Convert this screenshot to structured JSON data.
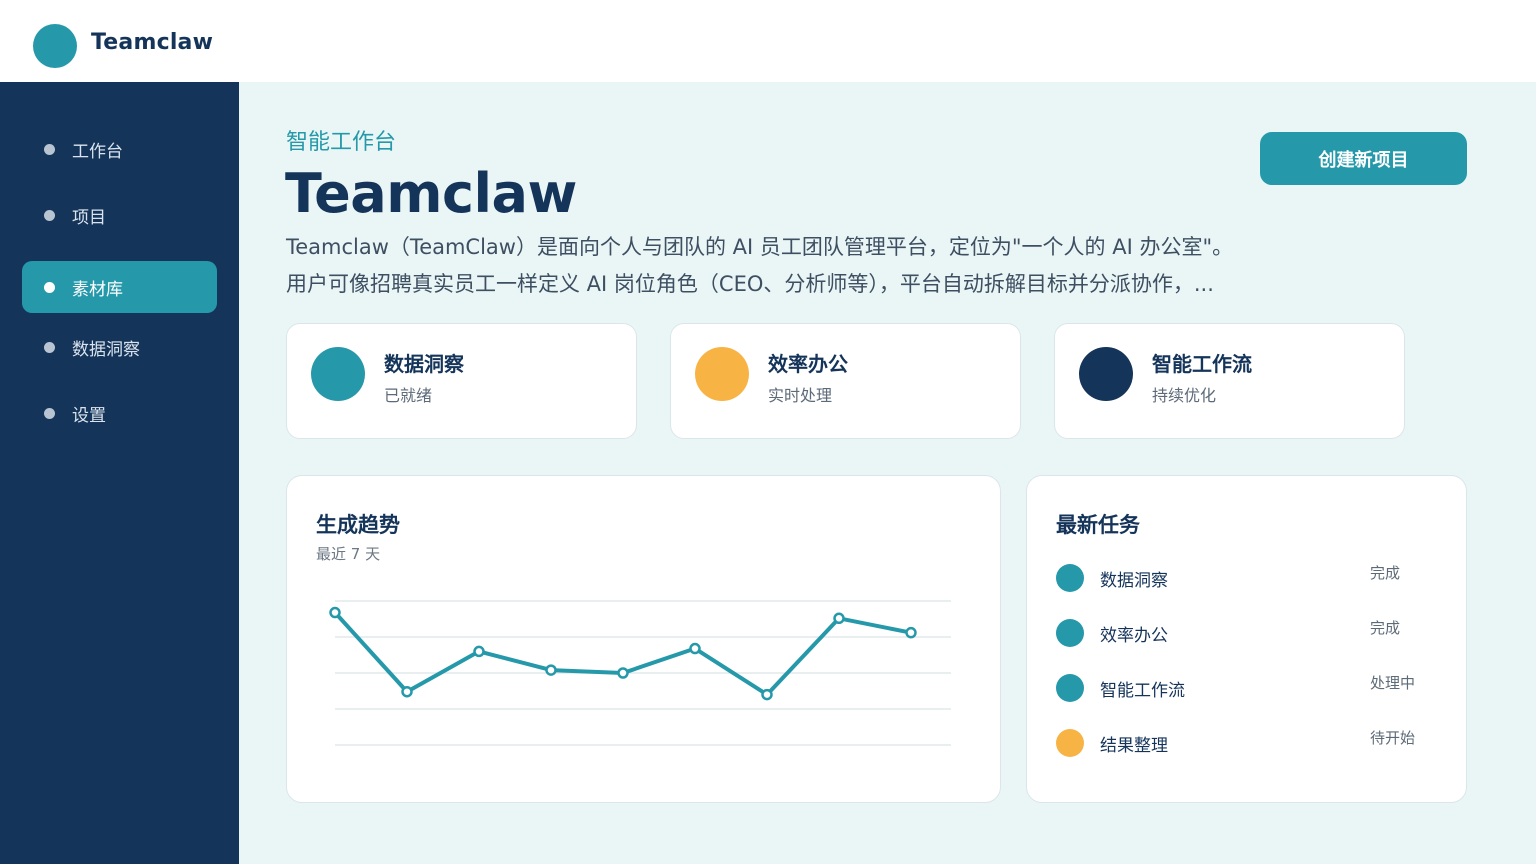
{
  "header": {
    "app_name": "Teamclaw"
  },
  "sidebar": {
    "items": [
      {
        "label": "工作台",
        "active": false
      },
      {
        "label": "项目",
        "active": false
      },
      {
        "label": "素材库",
        "active": true
      },
      {
        "label": "数据洞察",
        "active": false
      },
      {
        "label": "设置",
        "active": false
      }
    ]
  },
  "main": {
    "subtitle": "智能工作台",
    "title": "Teamclaw",
    "description_lines": [
      "Teamclaw（TeamClaw）是面向个人与团队的 AI 员工团队管理平台，定位为\"一个人的 AI 办公室\"。",
      "用户可像招聘真实员工一样定义 AI 岗位角色（CEO、分析师等），平台自动拆解目标并分派协作，..."
    ],
    "create_button": "创建新项目",
    "stats": [
      {
        "title": "数据洞察",
        "subtitle": "已就绪",
        "color": "#2599aa"
      },
      {
        "title": "效率办公",
        "subtitle": "实时处理",
        "color": "#f7b445"
      },
      {
        "title": "智能工作流",
        "subtitle": "持续优化",
        "color": "#15345a"
      }
    ],
    "trend": {
      "title": "生成趋势",
      "subtitle": "最近 7 天"
    },
    "tasks": {
      "title": "最新任务",
      "items": [
        {
          "name": "数据洞察",
          "status": "完成",
          "color": "#2599aa"
        },
        {
          "name": "效率办公",
          "status": "完成",
          "color": "#2599aa"
        },
        {
          "name": "智能工作流",
          "status": "处理中",
          "color": "#2599aa"
        },
        {
          "name": "结果整理",
          "status": "待开始",
          "color": "#f7b445"
        }
      ]
    }
  },
  "chart_data": {
    "type": "line",
    "x": [
      1,
      2,
      3,
      4,
      5,
      6,
      7,
      8,
      9
    ],
    "series": [
      {
        "values": [
          92,
          37,
          65,
          52,
          50,
          67,
          35,
          88,
          78
        ]
      }
    ],
    "ylim": [
      0,
      100
    ],
    "grid": true,
    "color": "#2599aa"
  },
  "colors": {
    "accent": "#2599aa",
    "navy": "#15345a",
    "orange": "#f7b445",
    "background": "#eaf6f6"
  }
}
